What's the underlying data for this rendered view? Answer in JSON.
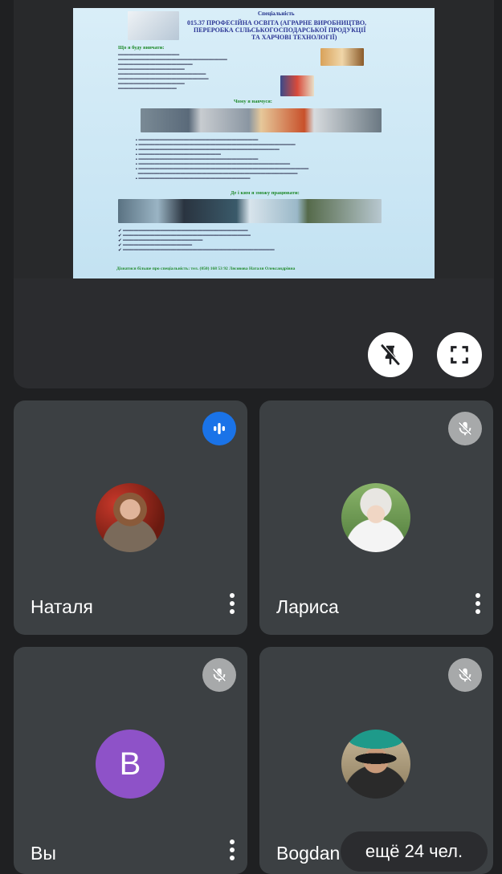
{
  "presentation": {
    "slide": {
      "header_word": "Спеціальність",
      "title_line1": "015.37 ПРОФЕСІЙНА ОСВІТА (АГРАРНЕ ВИРОБНИЦТВО,",
      "title_line2": "ПЕРЕРОБКА СІЛЬСЬКОГОСПОДАРСЬКОЇ ПРОДУКЦІЇ",
      "title_line3": "ТА ХАРЧОВІ ТЕХНОЛОГІЇ)",
      "section1": "Що я буду вивчати:",
      "section2": "Чому я навчуся:",
      "section3": "Де і ким я зможу працювати:",
      "contact": "Дізнатися більше про спеціальність: тел. (050) 168 53 92 Лясовова Наталя Олександрівна"
    },
    "unpin_icon": "unpin-icon",
    "fullscreen_icon": "fullscreen-icon"
  },
  "participants": [
    {
      "name": "Наталя",
      "state": "speaking",
      "avatar_type": "photo"
    },
    {
      "name": "Лариса",
      "state": "muted",
      "avatar_type": "photo"
    },
    {
      "name": "Вы",
      "state": "muted",
      "avatar_type": "letter",
      "initial": "B",
      "color": "#8e52c8"
    },
    {
      "name": "Bogdan",
      "state": "muted",
      "avatar_type": "photo"
    }
  ],
  "more_participants": "ещё 24 чел.",
  "colors": {
    "tile": "#3c4043",
    "accent_blue": "#1a73e8",
    "background": "#1f2022"
  }
}
